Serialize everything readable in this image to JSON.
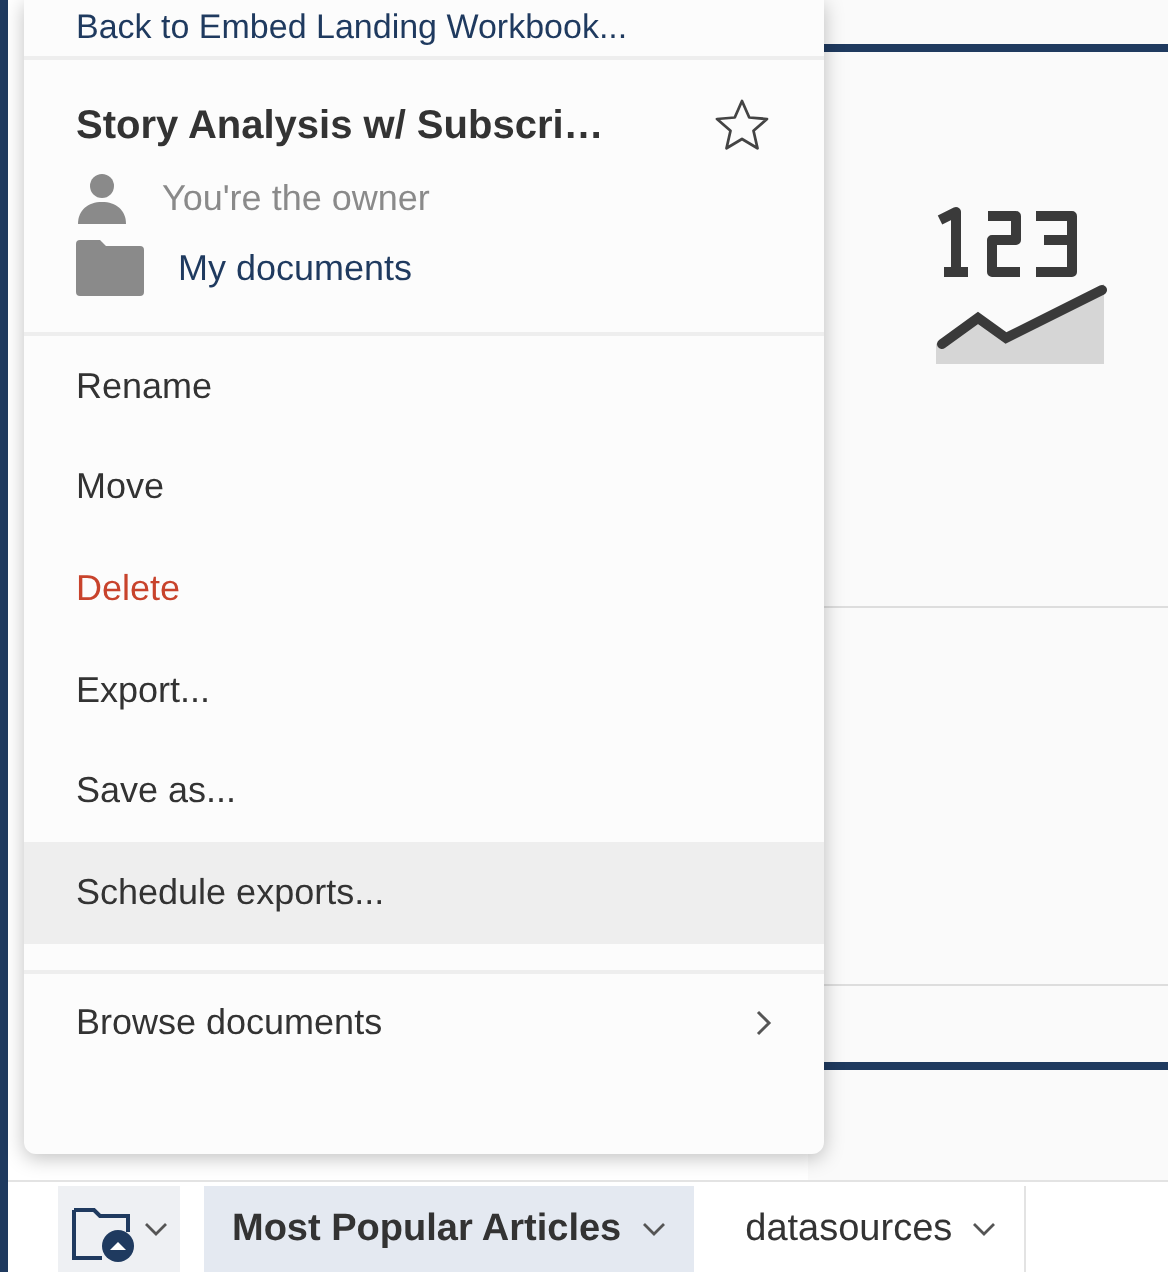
{
  "menu": {
    "back_link": "Back to Embed Landing Workbook...",
    "document": {
      "title": "Story Analysis w/ Subscri…",
      "starred": false,
      "owner": "You're the owner",
      "folder": "My documents"
    },
    "items": [
      {
        "label": "Rename",
        "kind": "normal",
        "highlighted": false
      },
      {
        "label": "Move",
        "kind": "normal",
        "highlighted": false
      },
      {
        "label": "Delete",
        "kind": "danger",
        "highlighted": false
      },
      {
        "label": "Export...",
        "kind": "normal",
        "highlighted": false
      },
      {
        "label": "Save as...",
        "kind": "normal",
        "highlighted": false
      },
      {
        "label": "Schedule exports...",
        "kind": "normal",
        "highlighted": true
      }
    ],
    "footer_items": [
      {
        "label": "Browse documents",
        "kind": "submenu",
        "highlighted": false
      }
    ]
  },
  "sheet_tabs": [
    {
      "label": "Most Popular Articles",
      "selected": true
    },
    {
      "label": "datasources",
      "selected": false
    }
  ]
}
